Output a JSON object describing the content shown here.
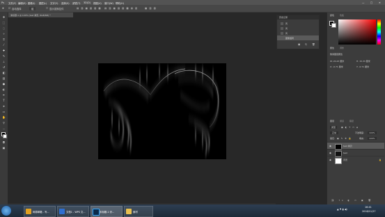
{
  "menu": {
    "items": [
      "文件(F)",
      "编辑(E)",
      "图像(I)",
      "图层(L)",
      "文字(Y)",
      "选择(S)",
      "滤镜(T)",
      "3D(D)",
      "视图(V)",
      "窗口(W)",
      "帮助(H)"
    ]
  },
  "options_bar": {
    "auto_select_label": "自动选择",
    "auto_select_value": "组",
    "transform_label": "显示变换控件"
  },
  "document": {
    "tab_title": "未标题-1 @ 100% (test 拷贝, RGB/8#) *"
  },
  "history_panel": {
    "title": "历史记录",
    "items": [
      "风",
      "风",
      "风",
      "图像旋转"
    ]
  },
  "color_panel": {
    "tabs": [
      "颜色",
      "色板"
    ],
    "fg_color": "#000000",
    "bg_color": "#ffffff"
  },
  "properties_panel": {
    "tabs": [
      "属性",
      "调整"
    ],
    "section": "像素图层属性",
    "w": "W: 20.43 厘米",
    "h": "H: 15.33 厘米",
    "x": "X: -0.71 厘米",
    "y": "Y: -0.71 厘米"
  },
  "layers_panel": {
    "tabs": [
      "图层",
      "通道",
      "路径"
    ],
    "kind_label": "类型",
    "blend_mode": "正常",
    "opacity_label": "不透明度:",
    "opacity_value": "100%",
    "lock_label": "锁定:",
    "fill_label": "填充:",
    "fill_value": "100%",
    "layers": [
      {
        "name": "test 拷贝",
        "selected": true
      },
      {
        "name": "test",
        "selected": false
      },
      {
        "name": "背景",
        "selected": false
      }
    ]
  },
  "taskbar": {
    "apps": [
      "网易邮箱 - 写...",
      "文档1 - WPS 文...",
      "未标题-1 @...",
      "素材"
    ],
    "time": "16:41",
    "date": "2018/11/27"
  }
}
